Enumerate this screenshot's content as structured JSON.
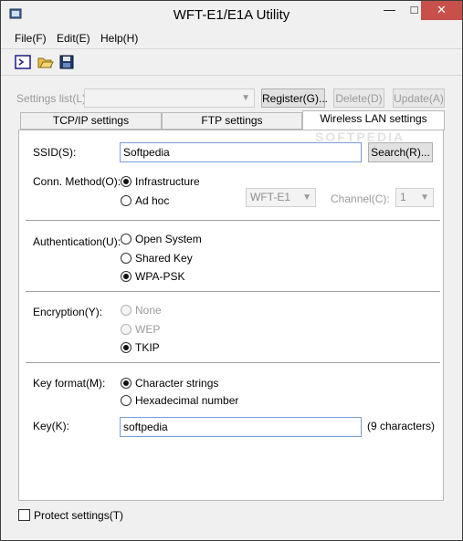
{
  "window": {
    "title": "WFT-E1/E1A Utility",
    "minimize": "—",
    "maximize": "□",
    "close": "✕"
  },
  "menu": {
    "file": "File(F)",
    "edit": "Edit(E)",
    "help": "Help(H)"
  },
  "toolbar": {
    "icons": [
      "terminal-icon",
      "open-folder-icon",
      "save-icon"
    ]
  },
  "settings_list": {
    "label": "Settings list(L):",
    "value": "",
    "register": "Register(G)...",
    "delete": "Delete(D)",
    "update": "Update(A)"
  },
  "tabs": [
    "TCP/IP settings",
    "FTP settings",
    "Wireless LAN settings"
  ],
  "watermark": "SOFTPEDIA",
  "wireless": {
    "ssid_label": "SSID(S):",
    "ssid_value": "Softpedia",
    "search_button": "Search(R)...",
    "conn_method_label": "Conn. Method(O):",
    "conn_infrastructure": "Infrastructure",
    "conn_adhoc": "Ad hoc",
    "adhoc_device": "WFT-E1",
    "channel_label": "Channel(C):",
    "channel_value": "1",
    "auth_label": "Authentication(U):",
    "auth_open": "Open System",
    "auth_shared": "Shared Key",
    "auth_wpa": "WPA-PSK",
    "enc_label": "Encryption(Y):",
    "enc_none": "None",
    "enc_wep": "WEP",
    "enc_tkip": "TKIP",
    "keyformat_label": "Key format(M):",
    "keyformat_char": "Character strings",
    "keyformat_hex": "Hexadecimal number",
    "key_label": "Key(K):",
    "key_value": "softpedia",
    "key_count": "(9 characters)"
  },
  "protect_settings": "Protect settings(T)"
}
